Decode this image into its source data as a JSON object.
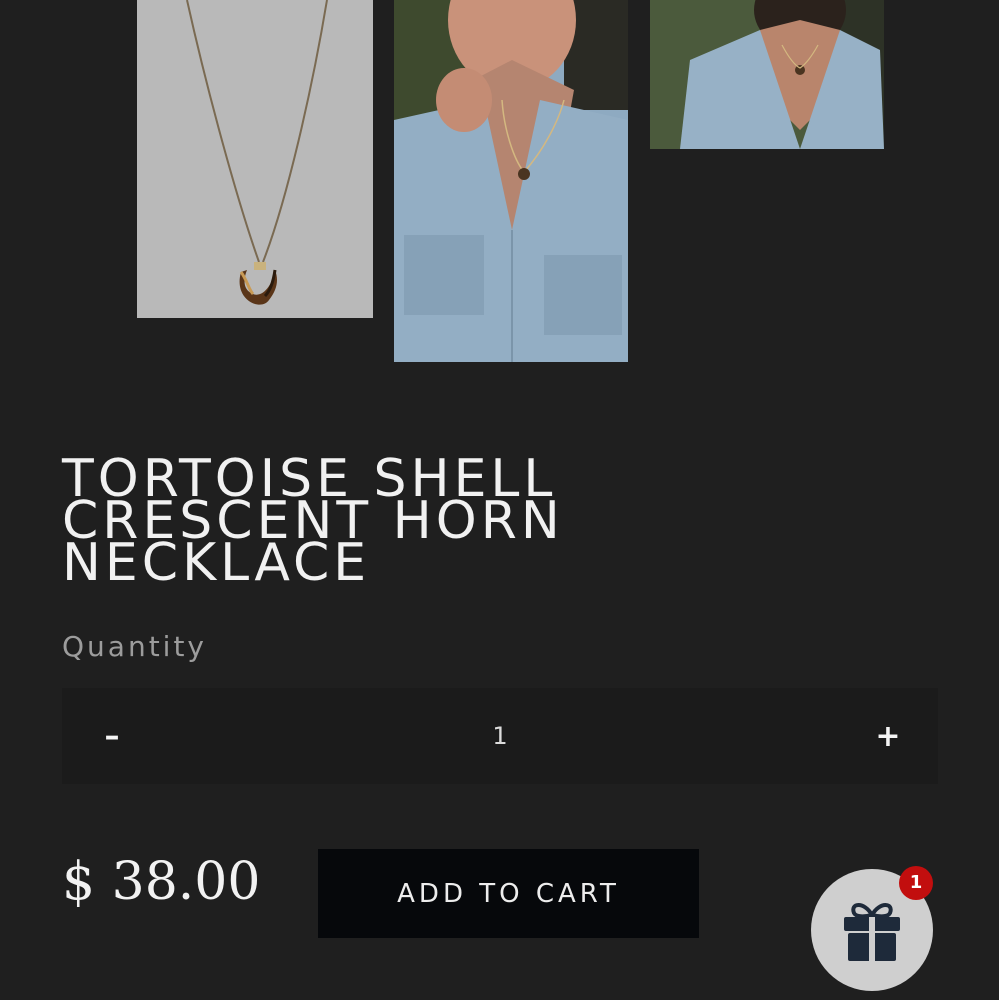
{
  "product": {
    "title": "TORTOISE SHELL CRESCENT HORN NECKLACE",
    "price": "$ 38.00"
  },
  "gallery": {
    "images": [
      {
        "name": "necklace-product-photo"
      },
      {
        "name": "model-wearing-necklace-closeup"
      },
      {
        "name": "model-wearing-necklace-wide"
      }
    ]
  },
  "quantity": {
    "label": "Quantity",
    "value": "1",
    "decrement_label": "–",
    "increment_label": "+"
  },
  "cart": {
    "add_label": "ADD TO CART"
  },
  "gift_widget": {
    "icon": "gift-icon",
    "badge_count": "1"
  },
  "colors": {
    "background": "#1f1f1f",
    "button": "#06080b",
    "badge": "#c20e0e"
  }
}
